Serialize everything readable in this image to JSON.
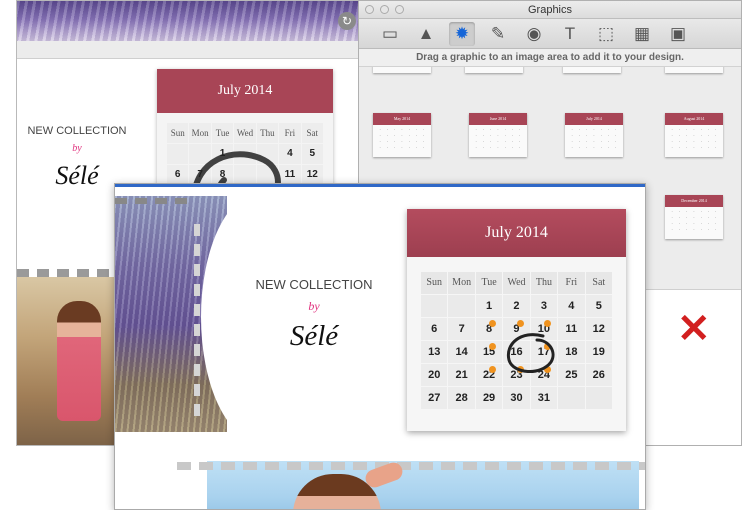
{
  "graphics_panel": {
    "title": "Graphics",
    "hint": "Drag a graphic to an image area to add it to your design.",
    "tools": [
      {
        "icon": "layout-icon",
        "glyph": "▭"
      },
      {
        "icon": "shape-icon",
        "glyph": "▲"
      },
      {
        "icon": "starburst-icon",
        "glyph": "✹"
      },
      {
        "icon": "feather-icon",
        "glyph": "✎"
      },
      {
        "icon": "media-icon",
        "glyph": "◉"
      },
      {
        "icon": "text-icon",
        "glyph": "T"
      },
      {
        "icon": "selection-icon",
        "glyph": "⬚"
      },
      {
        "icon": "pattern-icon",
        "glyph": "▦"
      },
      {
        "icon": "image-icon",
        "glyph": "▣"
      }
    ],
    "mini_calendars": [
      {
        "month": ""
      },
      {
        "month": "May 2014"
      },
      {
        "month": "June 2014"
      },
      {
        "month": "July 2014"
      },
      {
        "month": "August 2014"
      },
      {
        "month": "December 2014"
      }
    ],
    "delete_glyph": "✕"
  },
  "background_design": {
    "title_line1": "NEW COLLECTION",
    "by": "by",
    "brand": "Sélé",
    "calendar": {
      "month": "July 2014",
      "dow": [
        "Sun",
        "Mon",
        "Tue",
        "Wed",
        "Thu",
        "Fri",
        "Sat"
      ],
      "visible_days": [
        "",
        "",
        "1",
        "",
        "",
        "4",
        "5",
        "6",
        "7",
        "8",
        "",
        "",
        "11",
        "12"
      ]
    }
  },
  "front_design": {
    "title_line1": "NEW COLLECTION",
    "by": "by",
    "brand": "Sélé",
    "calendar": {
      "month": "July 2014",
      "dow": [
        "Sun",
        "Mon",
        "Tue",
        "Wed",
        "Thu",
        "Fri",
        "Sat"
      ],
      "weeks": [
        [
          "",
          "",
          "1",
          "2",
          "3",
          "4",
          "5"
        ],
        [
          "6",
          "7",
          "8",
          "9",
          "10",
          "11",
          "12"
        ],
        [
          "13",
          "14",
          "15",
          "16",
          "17",
          "18",
          "19"
        ],
        [
          "20",
          "21",
          "22",
          "23",
          "24",
          "25",
          "26"
        ],
        [
          "27",
          "28",
          "29",
          "30",
          "31",
          "",
          ""
        ]
      ],
      "highlighted_day": "16",
      "dotted_days": [
        "8",
        "9",
        "10",
        "15",
        "17",
        "22",
        "23",
        "24"
      ]
    }
  },
  "colors": {
    "calendar_header": "#a84556",
    "brand_by": "#e0317d",
    "delete": "#d21f1f",
    "event_dot": "#f0931f"
  }
}
